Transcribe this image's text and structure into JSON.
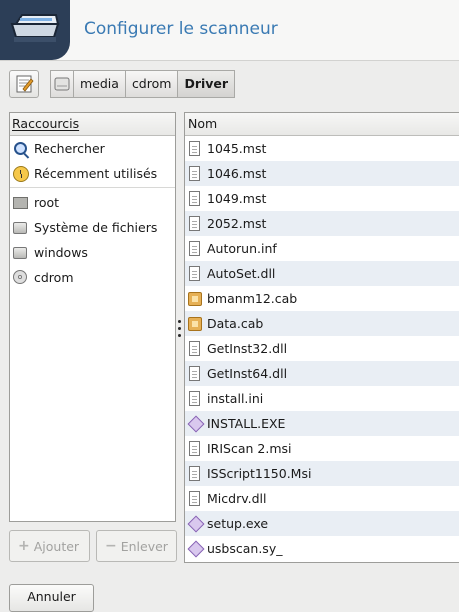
{
  "header": {
    "title": "Configurer le scanneur",
    "icon": "scanner-icon",
    "accent": "#3a7ab3"
  },
  "toolbar": {
    "edit_icon": "edit-location-icon",
    "toggle_icon": "drive-toggle-icon"
  },
  "breadcrumb": [
    {
      "label": "media"
    },
    {
      "label": "cdrom"
    },
    {
      "label": "Driver",
      "active": true
    }
  ],
  "places": {
    "header": "Raccourcis",
    "items": [
      {
        "label": "Rechercher",
        "icon": "search-icon"
      },
      {
        "label": "Récemment utilisés",
        "icon": "recent-icon"
      },
      {
        "label": "root",
        "icon": "home-folder-icon"
      },
      {
        "label": "Système de fichiers",
        "icon": "drive-icon"
      },
      {
        "label": "windows",
        "icon": "drive-icon"
      },
      {
        "label": "cdrom",
        "icon": "cdrom-icon"
      }
    ]
  },
  "files": {
    "header": "Nom",
    "items": [
      {
        "name": "1045.mst",
        "icon": "document-icon"
      },
      {
        "name": "1046.mst",
        "icon": "document-icon"
      },
      {
        "name": "1049.mst",
        "icon": "document-icon"
      },
      {
        "name": "2052.mst",
        "icon": "document-icon"
      },
      {
        "name": "Autorun.inf",
        "icon": "document-icon"
      },
      {
        "name": "AutoSet.dll",
        "icon": "document-icon"
      },
      {
        "name": "bmanm12.cab",
        "icon": "archive-icon"
      },
      {
        "name": "Data.cab",
        "icon": "archive-icon"
      },
      {
        "name": "GetInst32.dll",
        "icon": "document-icon"
      },
      {
        "name": "GetInst64.dll",
        "icon": "document-icon"
      },
      {
        "name": "install.ini",
        "icon": "document-icon"
      },
      {
        "name": "INSTALL.EXE",
        "icon": "executable-icon"
      },
      {
        "name": "IRIScan 2.msi",
        "icon": "document-icon"
      },
      {
        "name": "ISScript1150.Msi",
        "icon": "document-icon"
      },
      {
        "name": "Micdrv.dll",
        "icon": "document-icon"
      },
      {
        "name": "setup.exe",
        "icon": "executable-icon"
      },
      {
        "name": "usbscan.sy_",
        "icon": "executable-icon"
      }
    ]
  },
  "buttons": {
    "add_label": "Ajouter",
    "remove_label": "Enlever",
    "cancel_label": "Annuler"
  }
}
